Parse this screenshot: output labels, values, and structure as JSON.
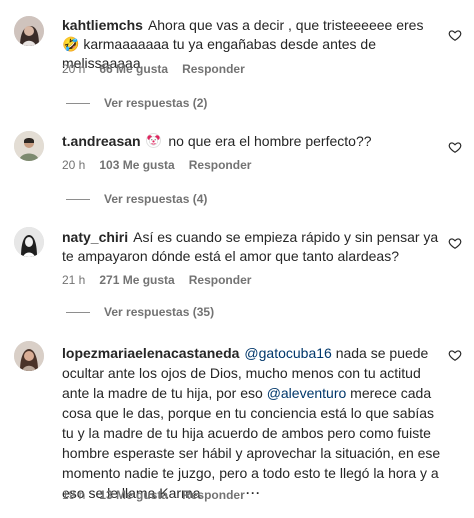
{
  "comments": [
    {
      "username": "kahtliemchs",
      "text": "Ahora que vas a decir , que tristeeeeee eres 🤣 karmaaaaaaa tu ya engañabas desde antes de melissaaaaa",
      "time": "20 h",
      "likes": "66 Me gusta",
      "reply": "Responder",
      "view_replies": "Ver respuestas (2)"
    },
    {
      "username": "t.andreasan",
      "text_before": "",
      "emoji": "🤡",
      "text_after": "no que era el hombre perfecto??",
      "time": "20 h",
      "likes": "103 Me gusta",
      "reply": "Responder",
      "view_replies": "Ver respuestas (4)"
    },
    {
      "username": "naty_chiri",
      "text": "Así es cuando se empieza rápido y sin pensar ya te ampayaron dónde está el amor que tanto alardeas?",
      "time": "21 h",
      "likes": "271 Me gusta",
      "reply": "Responder",
      "view_replies": "Ver respuestas (35)"
    },
    {
      "username": "lopezmariaelenacastaneda",
      "mention1": "@gatocuba16",
      "text_part1": "nada se puede ocultar ante los ojos de Dios, mucho menos con tu actitud ante la madre de tu hija, por eso",
      "mention2": "@aleventuro",
      "text_part2": "merece cada cosa que le das, porque en tu conciencia está lo que sabías tu y la madre de tu hija acuerdo de ambos pero como fuiste hombre esperaste ser hábil y aprovechar la situación, en ese momento nadie te juzgo, pero a todo esto te llegó la hora y a eso se le llama Karma.",
      "time": "19 h",
      "likes": "13 Me gusta",
      "reply": "Responder",
      "more": "···"
    }
  ],
  "icons": {
    "like": "heart-outline-icon",
    "more": "more-options-icon"
  },
  "colors": {
    "text": "#262626",
    "secondary": "#737373",
    "mention": "#00376b",
    "background": "#ffffff"
  }
}
